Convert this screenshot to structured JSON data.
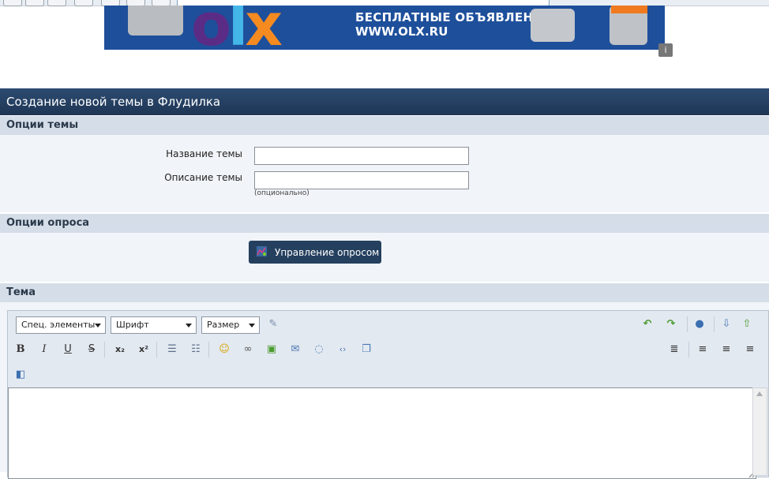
{
  "banner": {
    "line1": "БЕСПЛАТНЫЕ ОБЪЯВЛЕНИЯ",
    "line2": "WWW.OLX.RU",
    "logo_o": "o",
    "logo_l": "l",
    "logo_x": "x",
    "info_icon": "i"
  },
  "page": {
    "title": "Создание новой темы в Флудилка"
  },
  "topic_options": {
    "header": "Опции темы",
    "name_label": "Название темы",
    "desc_label": "Описание темы",
    "desc_hint": "(опционально)",
    "name_value": "",
    "desc_value": ""
  },
  "poll_options": {
    "header": "Опции опроса",
    "button_label": "Управление опросом"
  },
  "editor": {
    "header": "Тема",
    "special_select": "Спец. элементы",
    "font_select": "Шрифт",
    "size_select": "Размер",
    "bold": "B",
    "italic": "I",
    "underline": "U",
    "strike": "S",
    "subscript": "x₂",
    "superscript": "x²",
    "content": ""
  },
  "colors": {
    "titlebar": "#25405f",
    "section_header": "#d4dde8",
    "section_body": "#f1f4f8"
  }
}
